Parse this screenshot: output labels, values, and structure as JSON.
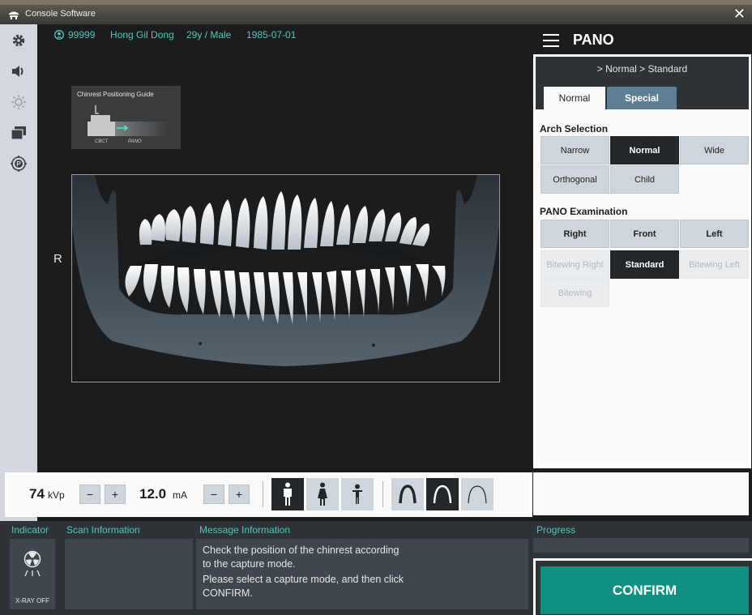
{
  "window": {
    "title": "Console Software"
  },
  "patient": {
    "id": "99999",
    "name": "Hong Gil Dong",
    "age_sex": "29y / Male",
    "dob": "1985-07-01"
  },
  "viewer": {
    "guide_title": "Chinrest Positioning Guide",
    "guide_label_cbct": "CBCT",
    "guide_label_pano": "PANO",
    "side_label": "R"
  },
  "panel": {
    "mode_title": "PANO",
    "breadcrumb": "> Normal > Standard",
    "tabs": {
      "normal": "Normal",
      "special": "Special"
    },
    "arch_title": "Arch Selection",
    "arch": {
      "narrow": "Narrow",
      "normal": "Normal",
      "wide": "Wide",
      "orthogonal": "Orthogonal",
      "child": "Child"
    },
    "exam_title": "PANO Examination",
    "exam": {
      "right": "Right",
      "front": "Front",
      "left": "Left",
      "bitewing_right": "Bitewing Right",
      "standard": "Standard",
      "bitewing_left": "Bitewing Left",
      "bitewing": "Bitewing"
    }
  },
  "controls": {
    "kvp_value": "74",
    "kvp_unit": "kVp",
    "ma_value": "12.0",
    "ma_unit": "mA",
    "minus": "−",
    "plus": "+"
  },
  "bottom": {
    "indicator_label": "Indicator",
    "scan_label": "Scan Information",
    "message_label": "Message Information",
    "progress_label": "Progress",
    "xray_status": "X-RAY OFF",
    "message_lines": [
      "Check the position of the chinrest according",
      "to the capture mode.",
      "Please select a capture mode, and then click",
      "CONFIRM."
    ],
    "confirm_label": "CONFIRM"
  },
  "colors": {
    "accent": "#52c7b8",
    "confirm": "#10907e",
    "selected": "#22272a",
    "tab_special": "#5d7f93"
  }
}
